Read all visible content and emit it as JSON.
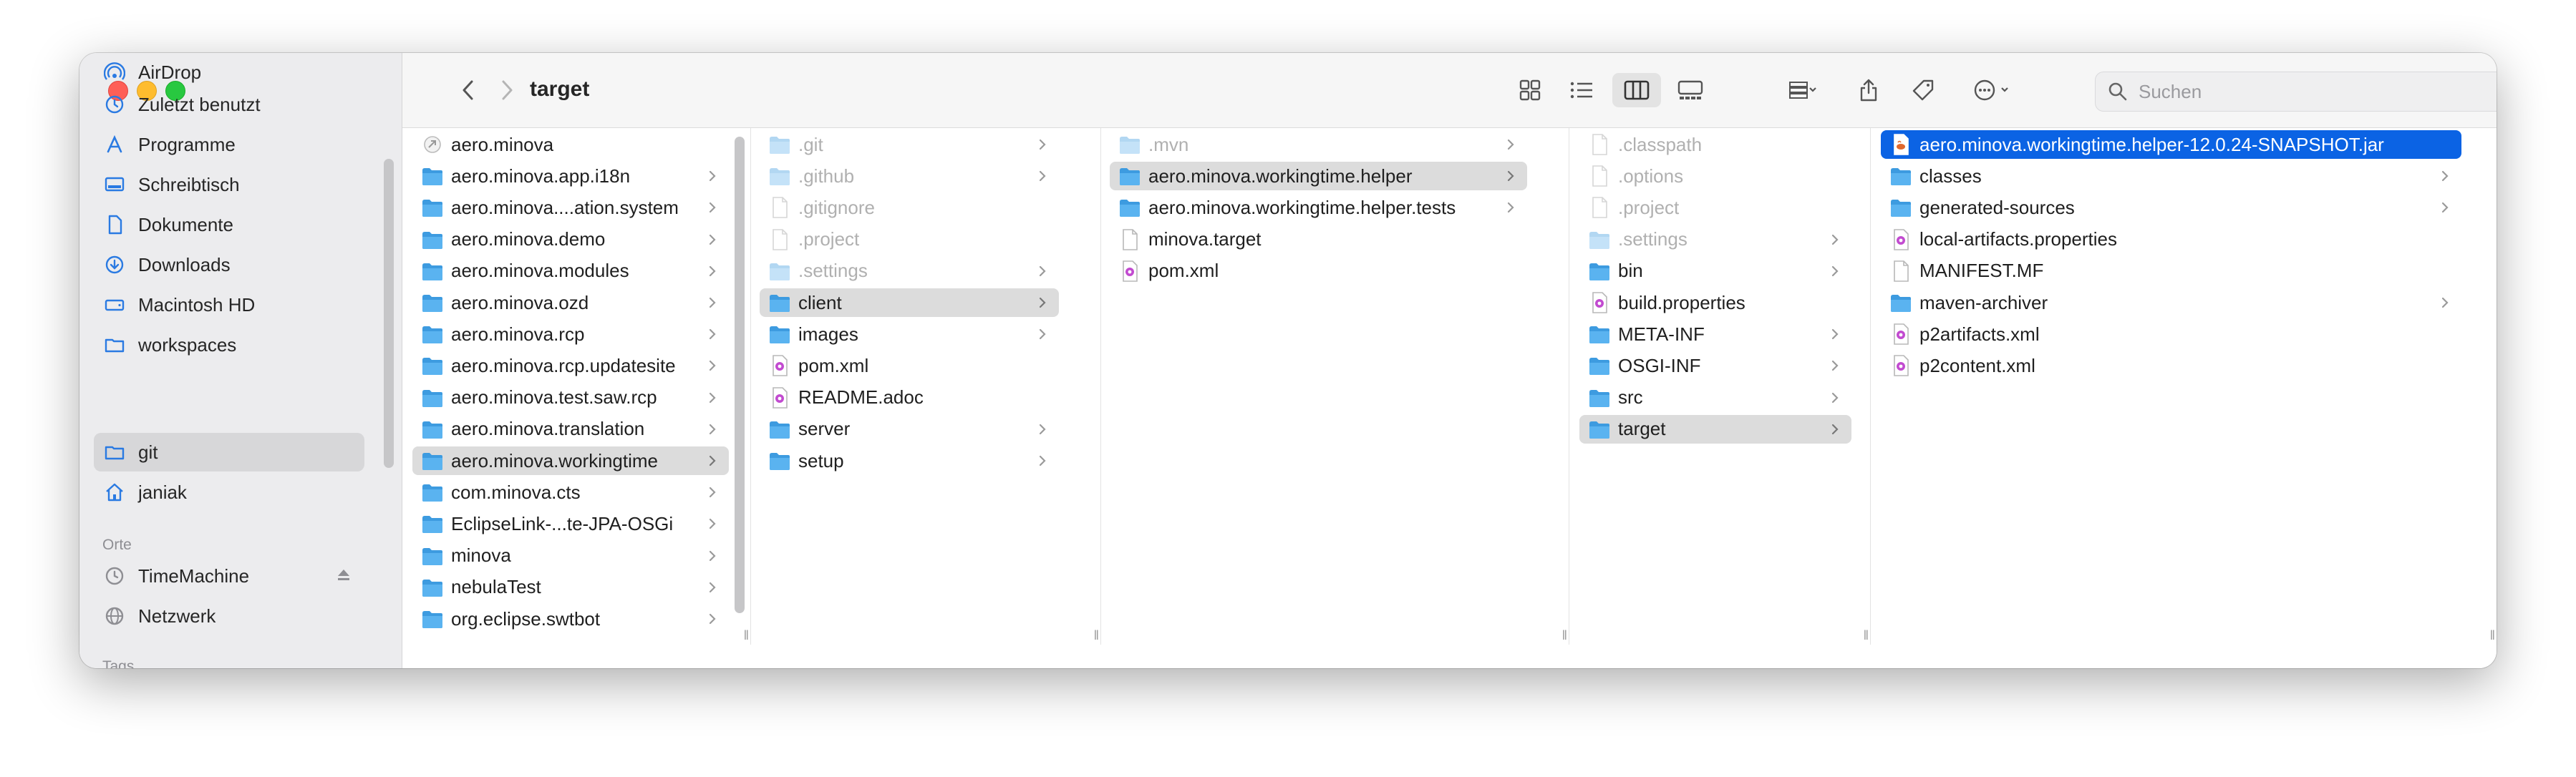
{
  "window": {
    "title": "target"
  },
  "toolbar": {
    "search_placeholder": "Suchen"
  },
  "sidebar": {
    "items": [
      {
        "label": "AirDrop",
        "icon": "airdrop-icon"
      },
      {
        "label": "Zuletzt benutzt",
        "icon": "clock-icon"
      },
      {
        "label": "Programme",
        "icon": "apps-icon"
      },
      {
        "label": "Schreibtisch",
        "icon": "desktop-icon"
      },
      {
        "label": "Dokumente",
        "icon": "document-icon"
      },
      {
        "label": "Downloads",
        "icon": "download-icon"
      },
      {
        "label": "Macintosh HD",
        "icon": "harddisk-icon"
      },
      {
        "label": "workspaces",
        "icon": "folder-icon"
      },
      {
        "label": "git",
        "icon": "folder-icon"
      },
      {
        "label": "janiak",
        "icon": "home-icon"
      }
    ],
    "section_orte": "Orte",
    "orte": [
      {
        "label": "TimeMachine",
        "icon": "timemachine-icon"
      },
      {
        "label": "Netzwerk",
        "icon": "network-icon"
      }
    ],
    "section_tags": "Tags"
  },
  "columns": [
    {
      "items": [
        {
          "name": "aero.minova",
          "type": "alias"
        },
        {
          "name": "aero.minova.app.i18n",
          "type": "folder"
        },
        {
          "name": "aero.minova....ation.system",
          "type": "folder"
        },
        {
          "name": "aero.minova.demo",
          "type": "folder"
        },
        {
          "name": "aero.minova.modules",
          "type": "folder"
        },
        {
          "name": "aero.minova.ozd",
          "type": "folder"
        },
        {
          "name": "aero.minova.rcp",
          "type": "folder"
        },
        {
          "name": "aero.minova.rcp.updatesite",
          "type": "folder"
        },
        {
          "name": "aero.minova.test.saw.rcp",
          "type": "folder"
        },
        {
          "name": "aero.minova.translation",
          "type": "folder"
        },
        {
          "name": "aero.minova.workingtime",
          "type": "folder"
        },
        {
          "name": "com.minova.cts",
          "type": "folder"
        },
        {
          "name": "EclipseLink-...te-JPA-OSGi",
          "type": "folder"
        },
        {
          "name": "minova",
          "type": "folder"
        },
        {
          "name": "nebulaTest",
          "type": "folder"
        },
        {
          "name": "org.eclipse.swtbot",
          "type": "folder"
        }
      ]
    },
    {
      "items": [
        {
          "name": ".git",
          "type": "folder"
        },
        {
          "name": ".github",
          "type": "folder"
        },
        {
          "name": ".gitignore",
          "type": "file"
        },
        {
          "name": ".project",
          "type": "file"
        },
        {
          "name": ".settings",
          "type": "folder"
        },
        {
          "name": "client",
          "type": "folder"
        },
        {
          "name": "images",
          "type": "folder"
        },
        {
          "name": "pom.xml",
          "type": "xml"
        },
        {
          "name": "README.adoc",
          "type": "xml"
        },
        {
          "name": "server",
          "type": "folder"
        },
        {
          "name": "setup",
          "type": "folder"
        }
      ]
    },
    {
      "items": [
        {
          "name": ".mvn",
          "type": "folder"
        },
        {
          "name": "aero.minova.workingtime.helper",
          "type": "folder"
        },
        {
          "name": "aero.minova.workingtime.helper.tests",
          "type": "folder"
        },
        {
          "name": "minova.target",
          "type": "file"
        },
        {
          "name": "pom.xml",
          "type": "xml"
        }
      ]
    },
    {
      "items": [
        {
          "name": ".classpath",
          "type": "file"
        },
        {
          "name": ".options",
          "type": "file"
        },
        {
          "name": ".project",
          "type": "file"
        },
        {
          "name": ".settings",
          "type": "folder"
        },
        {
          "name": "bin",
          "type": "folder"
        },
        {
          "name": "build.properties",
          "type": "xml"
        },
        {
          "name": "META-INF",
          "type": "folder"
        },
        {
          "name": "OSGI-INF",
          "type": "folder"
        },
        {
          "name": "src",
          "type": "folder"
        },
        {
          "name": "target",
          "type": "folder"
        }
      ]
    },
    {
      "items": [
        {
          "name": "aero.minova.workingtime.helper-12.0.24-SNAPSHOT.jar",
          "type": "jar"
        },
        {
          "name": "classes",
          "type": "folder"
        },
        {
          "name": "generated-sources",
          "type": "folder"
        },
        {
          "name": "local-artifacts.properties",
          "type": "xml"
        },
        {
          "name": "MANIFEST.MF",
          "type": "file"
        },
        {
          "name": "maven-archiver",
          "type": "folder"
        },
        {
          "name": "p2artifacts.xml",
          "type": "xml"
        },
        {
          "name": "p2content.xml",
          "type": "xml"
        }
      ]
    }
  ],
  "colors": {
    "selection": "#0b63e4",
    "folder": "#5ab3f0",
    "sidebar_accent": "#2a7ae2"
  }
}
